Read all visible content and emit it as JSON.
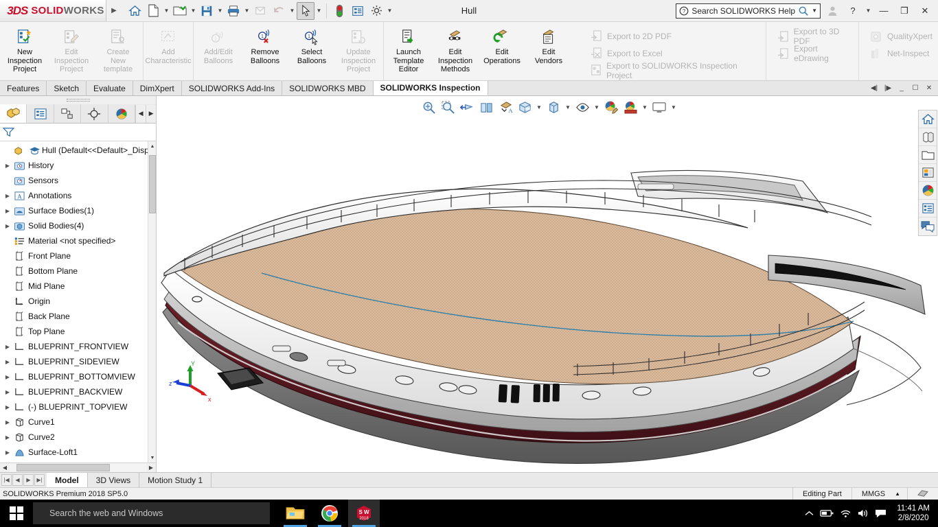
{
  "titlebar": {
    "logo_3ds": "3DS",
    "logo_bold": "SOLID",
    "logo_light": "WORKS",
    "document_title": "Hull",
    "expander_icon": "expand-menu-arrow-icon",
    "icons": [
      {
        "name": "home-icon",
        "label": "Home"
      },
      {
        "name": "new-document-icon",
        "label": "New"
      },
      {
        "name": "open-folder-icon",
        "label": "Open"
      },
      {
        "name": "save-icon",
        "label": "Save"
      },
      {
        "name": "print-icon",
        "label": "Print"
      },
      {
        "name": "undo-icon",
        "label": "Undo"
      },
      {
        "name": "select-cursor-icon",
        "label": "Select"
      },
      {
        "name": "rebuild-icon",
        "label": "Rebuild"
      },
      {
        "name": "options-list-icon",
        "label": "Options List"
      },
      {
        "name": "gear-icon",
        "label": "Options"
      }
    ],
    "help_search_placeholder": "Search SOLIDWORKS Help",
    "help_search_value": "",
    "window_controls": {
      "minimize": "—",
      "restore": "❐",
      "close": "✕",
      "help": "?",
      "user": "user-account-icon"
    }
  },
  "ribbon": {
    "groups": [
      {
        "buttons": [
          {
            "label": "New\nInspection\nProject",
            "icon": "new-inspection-project-icon",
            "disabled": false
          },
          {
            "label": "Edit\nInspection\nProject",
            "icon": "edit-inspection-project-icon",
            "disabled": true
          },
          {
            "label": "Create\nNew\ntemplate",
            "icon": "create-new-template-icon",
            "disabled": true
          }
        ]
      },
      {
        "buttons": [
          {
            "label": "Add\nCharacteristic",
            "icon": "add-characteristic-icon",
            "disabled": true
          }
        ]
      },
      {
        "buttons": [
          {
            "label": "Add/Edit\nBalloons",
            "icon": "add-edit-balloons-icon",
            "disabled": true
          },
          {
            "label": "Remove\nBalloons",
            "icon": "remove-balloons-icon",
            "disabled": false
          },
          {
            "label": "Select\nBalloons",
            "icon": "select-balloons-icon",
            "disabled": false
          },
          {
            "label": "Update\nInspection\nProject",
            "icon": "update-inspection-project-icon",
            "disabled": true
          }
        ]
      },
      {
        "buttons": [
          {
            "label": "Launch\nTemplate\nEditor",
            "icon": "launch-template-editor-icon",
            "disabled": false
          },
          {
            "label": "Edit\nInspection\nMethods",
            "icon": "edit-inspection-methods-icon",
            "disabled": false
          },
          {
            "label": "Edit\nOperations",
            "icon": "edit-operations-icon",
            "disabled": false
          },
          {
            "label": "Edit\nVendors",
            "icon": "edit-vendors-icon",
            "disabled": false
          }
        ]
      }
    ],
    "export_columns": [
      {
        "rows": [
          {
            "label": "Export to 2D PDF",
            "icon": "export-pdf-icon"
          },
          {
            "label": "Export to Excel",
            "icon": "export-excel-icon"
          },
          {
            "label": "Export to SOLIDWORKS Inspection Project",
            "icon": "export-inspection-icon"
          }
        ]
      },
      {
        "rows": [
          {
            "label": "Export to 3D PDF",
            "icon": "export-3dpdf-icon"
          },
          {
            "label": "Export eDrawing",
            "icon": "export-edrawing-icon"
          }
        ]
      },
      {
        "rows": [
          {
            "label": "QualityXpert",
            "icon": "qualityxpert-icon"
          },
          {
            "label": "Net-Inspect",
            "icon": "net-inspect-icon"
          }
        ]
      }
    ]
  },
  "tabs": {
    "items": [
      {
        "label": "Features",
        "active": false
      },
      {
        "label": "Sketch",
        "active": false
      },
      {
        "label": "Evaluate",
        "active": false
      },
      {
        "label": "DimXpert",
        "active": false
      },
      {
        "label": "SOLIDWORKS Add-Ins",
        "active": false
      },
      {
        "label": "SOLIDWORKS MBD",
        "active": false
      },
      {
        "label": "SOLIDWORKS Inspection",
        "active": true
      }
    ],
    "right_controls": [
      "pin-left-icon",
      "pin-right-icon",
      "minimize-icon",
      "restore-icon",
      "close-icon"
    ]
  },
  "left_panel": {
    "tabs": [
      {
        "name": "feature-manager-tab",
        "icon": "feature-tree-icon",
        "active": true
      },
      {
        "name": "property-manager-tab",
        "icon": "property-manager-icon",
        "active": false
      },
      {
        "name": "configuration-manager-tab",
        "icon": "configuration-manager-icon",
        "active": false
      },
      {
        "name": "dimxpert-manager-tab",
        "icon": "dimxpert-icon",
        "active": false
      },
      {
        "name": "display-manager-tab",
        "icon": "display-manager-icon",
        "active": false
      }
    ],
    "filter_placeholder": "",
    "filter_icon": "filter-funnel-icon",
    "tree": [
      {
        "label": "Hull  (Default<<Default>_Disp",
        "icon": "part-icon",
        "twist": false,
        "root": true,
        "indent": 0
      },
      {
        "label": "History",
        "icon": "history-icon",
        "twist": true,
        "indent": 1
      },
      {
        "label": "Sensors",
        "icon": "sensors-icon",
        "twist": false,
        "indent": 1
      },
      {
        "label": "Annotations",
        "icon": "annotations-icon",
        "twist": true,
        "indent": 1
      },
      {
        "label": "Surface Bodies(1)",
        "icon": "surface-bodies-icon",
        "twist": true,
        "indent": 1
      },
      {
        "label": "Solid Bodies(4)",
        "icon": "solid-bodies-icon",
        "twist": true,
        "indent": 1
      },
      {
        "label": "Material <not specified>",
        "icon": "material-icon",
        "twist": false,
        "indent": 1
      },
      {
        "label": "Front Plane",
        "icon": "plane-icon",
        "twist": false,
        "indent": 1
      },
      {
        "label": "Bottom Plane",
        "icon": "plane-icon",
        "twist": false,
        "indent": 1
      },
      {
        "label": "Mid Plane",
        "icon": "plane-icon",
        "twist": false,
        "indent": 1
      },
      {
        "label": "Origin",
        "icon": "origin-icon",
        "twist": false,
        "indent": 1
      },
      {
        "label": "Back Plane",
        "icon": "plane-icon",
        "twist": false,
        "indent": 1
      },
      {
        "label": "Top Plane",
        "icon": "plane-icon",
        "twist": false,
        "indent": 1
      },
      {
        "label": "BLUEPRINT_FRONTVIEW",
        "icon": "sketch-icon",
        "twist": true,
        "indent": 1
      },
      {
        "label": "BLUEPRINT_SIDEVIEW",
        "icon": "sketch-icon",
        "twist": true,
        "indent": 1
      },
      {
        "label": "BLUEPRINT_BOTTOMVIEW",
        "icon": "sketch-icon",
        "twist": true,
        "indent": 1
      },
      {
        "label": "BLUEPRINT_BACKVIEW",
        "icon": "sketch-icon",
        "twist": true,
        "indent": 1
      },
      {
        "label": "(-) BLUEPRINT_TOPVIEW",
        "icon": "sketch-icon",
        "twist": true,
        "indent": 1
      },
      {
        "label": "Curve1",
        "icon": "curve-icon",
        "twist": true,
        "indent": 1
      },
      {
        "label": "Curve2",
        "icon": "curve-icon",
        "twist": true,
        "indent": 1
      },
      {
        "label": "Surface-Loft1",
        "icon": "surface-loft-icon",
        "twist": true,
        "indent": 1
      }
    ]
  },
  "viewport": {
    "heads_up_tools": [
      {
        "name": "zoom-to-fit-icon",
        "caret": false
      },
      {
        "name": "zoom-to-area-icon",
        "caret": false
      },
      {
        "name": "previous-view-icon",
        "caret": false
      },
      {
        "name": "section-view-icon",
        "caret": false
      },
      {
        "name": "view-orientation-icon",
        "caret": false
      },
      {
        "name": "view-orientation-cube-icon",
        "caret": true
      },
      {
        "name": "display-style-icon",
        "caret": true
      },
      {
        "name": "hide-show-items-icon",
        "caret": true
      },
      {
        "name": "edit-appearance-icon",
        "caret": false
      },
      {
        "name": "apply-scene-icon",
        "caret": true
      },
      {
        "name": "view-settings-icon",
        "caret": true
      }
    ],
    "task_pane_rail": [
      {
        "name": "resources-home-icon"
      },
      {
        "name": "design-library-icon"
      },
      {
        "name": "file-explorer-icon"
      },
      {
        "name": "view-palette-icon"
      },
      {
        "name": "appearances-scenes-icon"
      },
      {
        "name": "custom-properties-icon"
      },
      {
        "name": "solidworks-forum-icon"
      }
    ],
    "triad": {
      "x_label": "x",
      "y_label": "Y",
      "z_label": "z",
      "x_color": "#d42020",
      "y_color": "#1f9e26",
      "z_color": "#1a3fd4"
    },
    "model": {
      "name": "yacht-hull-model",
      "deck_color": "#d9b89a",
      "hull_color": "#5d1a22",
      "superstructure_color": "#f2f2f2",
      "accent_line_color": "#2f7fa8",
      "shadow_color": "#8e8e8e"
    }
  },
  "bottom_tabs": {
    "nav_buttons": [
      "first-icon",
      "previous-icon",
      "next-icon",
      "last-icon"
    ],
    "items": [
      {
        "label": "Model",
        "active": true
      },
      {
        "label": "3D Views",
        "active": false
      },
      {
        "label": "Motion Study 1",
        "active": false
      }
    ]
  },
  "status_bar": {
    "version": "SOLIDWORKS Premium 2018 SP5.0",
    "edit_state": "Editing Part",
    "units": "MMGS",
    "units_caret": "▲",
    "overlay_icon": "status-overlay-icon"
  },
  "taskbar": {
    "start_icon": "windows-start-icon",
    "search_placeholder": "Search the web and Windows",
    "apps": [
      {
        "name": "file-explorer-taskbar-icon",
        "open": true
      },
      {
        "name": "chrome-taskbar-icon",
        "open": true
      },
      {
        "name": "solidworks-taskbar-icon",
        "open": true,
        "active": true,
        "badge": "2018"
      }
    ],
    "tray": [
      {
        "name": "show-hidden-icons-icon"
      },
      {
        "name": "battery-icon"
      },
      {
        "name": "wifi-icon"
      },
      {
        "name": "volume-icon"
      },
      {
        "name": "action-center-icon"
      }
    ],
    "time": "11:41 AM",
    "date": "2/8/2020"
  }
}
